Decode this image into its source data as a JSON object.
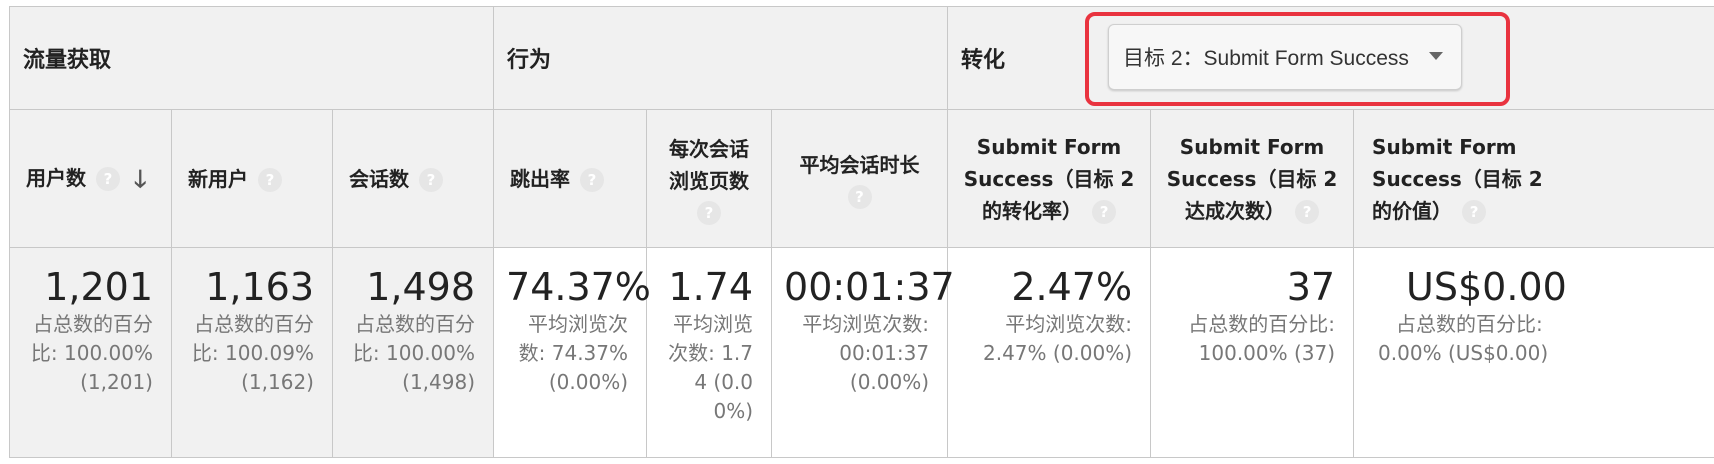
{
  "groups": {
    "acquisition": "流量获取",
    "behavior": "行为",
    "conversion": "转化"
  },
  "goal_selector": {
    "selected": "目标 2：Submit Form Success"
  },
  "columns": [
    {
      "key": "users",
      "label": "用户数",
      "help": "?"
    },
    {
      "key": "new_users",
      "label": "新用户",
      "help": "?"
    },
    {
      "key": "sessions",
      "label": "会话数",
      "help": "?"
    },
    {
      "key": "bounce_rate",
      "label": "跳出率",
      "help": "?"
    },
    {
      "key": "pages_per_session",
      "label_line1": "每次会话",
      "label_line2": "浏览页数",
      "help": "?"
    },
    {
      "key": "avg_session_duration",
      "label": "平均会话时长",
      "help": "?"
    },
    {
      "key": "goal_conv_rate",
      "label_line1": "Submit Form",
      "label_line2": "Success（目标 2",
      "label_line3": "的转化率）",
      "help": "?"
    },
    {
      "key": "goal_completions",
      "label_line1": "Submit Form",
      "label_line2": "Success（目标 2",
      "label_line3": "达成次数）",
      "help": "?"
    },
    {
      "key": "goal_value",
      "label_line1": "Submit Form",
      "label_line2": "Success（目标 2",
      "label_line3": "的价值）",
      "help": "?"
    }
  ],
  "sort_icon": "arrow-down-icon",
  "totals": [
    {
      "value": "1,201",
      "sub": "占总数的百分比: 100.00% (1,201)"
    },
    {
      "value": "1,163",
      "sub": "占总数的百分比: 100.09% (1,162)"
    },
    {
      "value": "1,498",
      "sub": "占总数的百分比: 100.00% (1,498)"
    },
    {
      "value": "74.37%",
      "sub": "平均浏览次数: 74.37% (0.00%)"
    },
    {
      "value": "1.74",
      "sub": "平均浏览次数: 1.74 (0.00%)"
    },
    {
      "value": "00:01:37",
      "sub_line1": "平均浏览次数:",
      "sub_line2": "00:01:37",
      "sub_line3": "(0.00%)"
    },
    {
      "value": "2.47%",
      "sub_line1": "平均浏览次数:",
      "sub_line2": "2.47% (0.00%)"
    },
    {
      "value": "37",
      "sub_line1": "占总数的百分比:",
      "sub_line2": "100.00% (37)"
    },
    {
      "value": "US$0.00",
      "sub_line1": "占总数的百分比:",
      "sub_line2": "0.00% (US$0.00)"
    }
  ]
}
